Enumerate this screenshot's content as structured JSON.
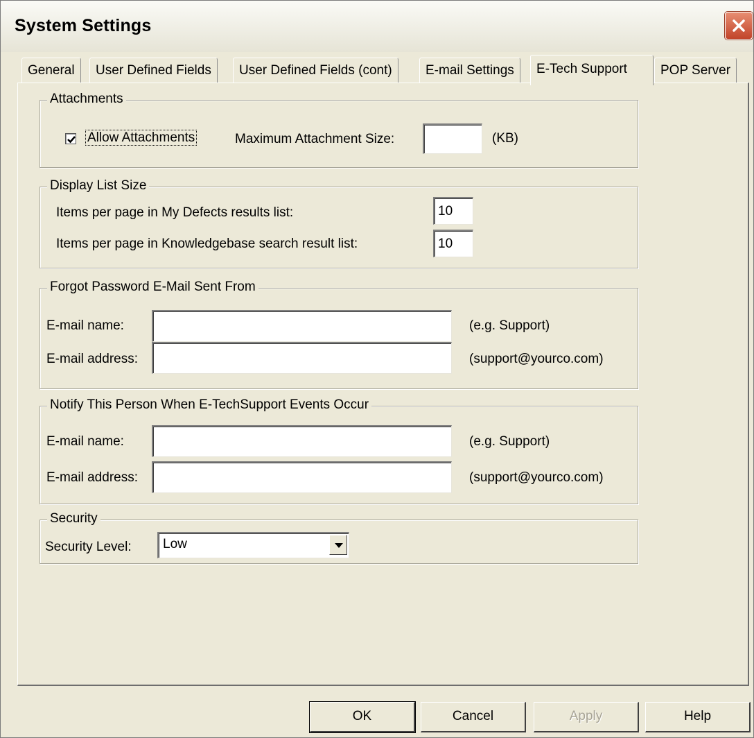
{
  "window": {
    "title": "System Settings"
  },
  "tabs": [
    {
      "label": "General"
    },
    {
      "label": "User Defined Fields"
    },
    {
      "label": "User Defined Fields (cont)"
    },
    {
      "label": "E-mail Settings"
    },
    {
      "label": "E-Tech Support",
      "active": true
    },
    {
      "label": "POP Server"
    }
  ],
  "attachments": {
    "legend": "Attachments",
    "allow_label": "Allow Attachments",
    "allow_checked": true,
    "max_size_label": "Maximum Attachment Size:",
    "max_size_value": "",
    "unit": "(KB)"
  },
  "display_list": {
    "legend": "Display List Size",
    "defects_label": "Items per page in My Defects results list:",
    "defects_value": "10",
    "kb_label": "Items per page in Knowledgebase search result list:",
    "kb_value": "10"
  },
  "forgot_password": {
    "legend": "Forgot Password E-Mail Sent From",
    "name_label": "E-mail name:",
    "name_value": "",
    "name_hint": "(e.g. Support)",
    "address_label": "E-mail address:",
    "address_value": "",
    "address_hint": "(support@yourco.com)"
  },
  "notify": {
    "legend": "Notify This Person When E-TechSupport Events Occur",
    "name_label": "E-mail name:",
    "name_value": "",
    "name_hint": "(e.g. Support)",
    "address_label": "E-mail address:",
    "address_value": "",
    "address_hint": "(support@yourco.com)"
  },
  "security": {
    "legend": "Security",
    "level_label": "Security Level:",
    "level_value": "Low"
  },
  "buttons": {
    "ok": "OK",
    "cancel": "Cancel",
    "apply": "Apply",
    "help": "Help"
  },
  "icons": {
    "close": "close-icon",
    "checkbox": "checkmark-icon",
    "dropdown": "chevron-down-icon"
  },
  "colors": {
    "dialog_bg": "#ece9d8",
    "close_button": "#c2442a"
  }
}
